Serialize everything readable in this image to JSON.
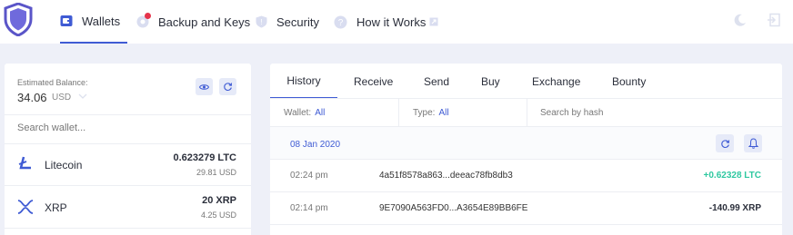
{
  "nav": {
    "wallets": "Wallets",
    "backup": "Backup and Keys",
    "security": "Security",
    "how": "How it Works"
  },
  "balance": {
    "label": "Estimated Balance:",
    "value": "34.06",
    "currency": "USD"
  },
  "search_wallet": {
    "placeholder": "Search wallet..."
  },
  "wallets": [
    {
      "name": "Litecoin",
      "amount": "0.623279 LTC",
      "usd": "29.81 USD",
      "icon": "litecoin-icon"
    },
    {
      "name": "XRP",
      "amount": "20 XRP",
      "usd": "4.25 USD",
      "icon": "xrp-icon"
    }
  ],
  "tabs": [
    "History",
    "Receive",
    "Send",
    "Buy",
    "Exchange",
    "Bounty"
  ],
  "filters": {
    "wallet_label": "Wallet:",
    "wallet_value": "All",
    "type_label": "Type:",
    "type_value": "All",
    "hash_placeholder": "Search by hash"
  },
  "date": "08 Jan 2020",
  "transactions": [
    {
      "time": "02:24 pm",
      "hash": "4a51f8578a863...deeac78fb8db3",
      "amount": "+0.62328 LTC",
      "color": "#2ec8a0"
    },
    {
      "time": "02:14 pm",
      "hash": "9E7090A563FD0...A3654E89BB6FE",
      "amount": "-140.99 XRP",
      "color": "#2b2f3b"
    }
  ],
  "colors": {
    "accent": "#3f5bd4",
    "positive": "#2ec8a0",
    "background": "#eef0f8"
  }
}
